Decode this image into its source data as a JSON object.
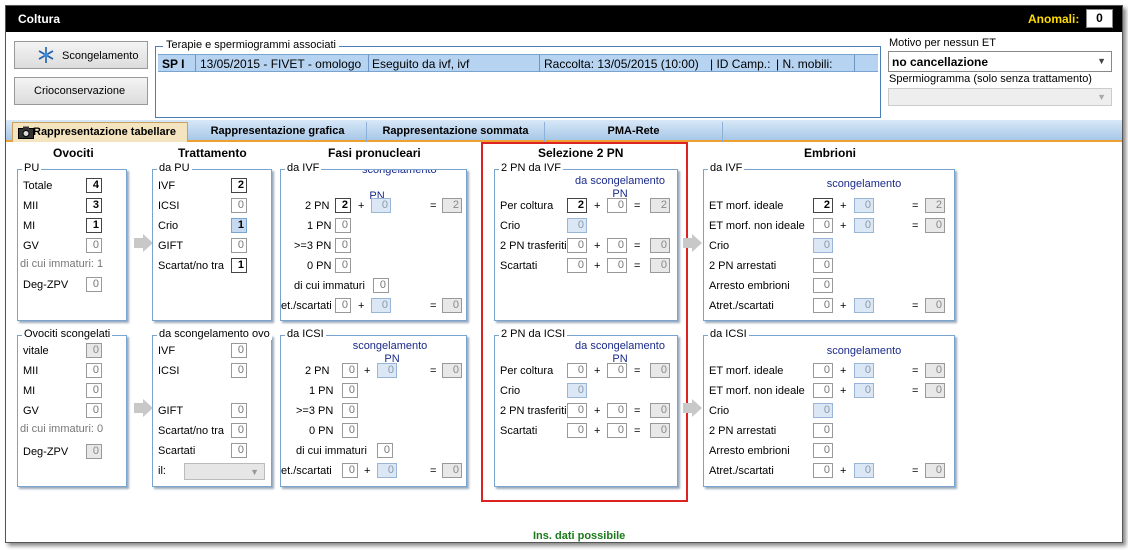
{
  "window": {
    "title": "Coltura",
    "anomali_label": "Anomali:",
    "anomali_value": "0"
  },
  "buttons": {
    "scongelamento": "Scongelamento",
    "crioconservazione": "Crioconservazione"
  },
  "associati": {
    "legend": "Terapie e spermiogrammi associati",
    "row": {
      "c1": "SP I",
      "c2": "13/05/2015 - FIVET - omologo",
      "c3": "Eseguito da ivf, ivf",
      "c4": "Raccolta: 13/05/2015 (10:00)",
      "c5": "| ID Camp.:",
      "c6": "| N. mobili:"
    }
  },
  "motivo": {
    "label": "Motivo per nessun ET",
    "value": "no cancellazione",
    "sperm_label": "Spermiogramma (solo senza trattamento)"
  },
  "tabs": [
    "Rappresentazione tabellare",
    "Rappresentazione grafica",
    "Rappresentazione sommata",
    "PMA-Rete"
  ],
  "headers": {
    "ovociti": "Ovociti",
    "trattamento": "Trattamento",
    "fasi": "Fasi pronucleari",
    "selezione": "Selezione 2 PN",
    "embrioni": "Embrioni"
  },
  "pu": {
    "legend": "PU",
    "rows": [
      {
        "label": "Totale",
        "value": "4"
      },
      {
        "label": "MII",
        "value": "3"
      },
      {
        "label": "MI",
        "value": "1"
      },
      {
        "label": "GV",
        "value": "0"
      }
    ],
    "immaturi": "di cui immaturi:  1",
    "deg_label": "Deg-ZPV",
    "deg_value": "0"
  },
  "scong": {
    "legend": "Ovociti scongelati",
    "rows": [
      {
        "label": "vitale",
        "value": "0"
      },
      {
        "label": "MII",
        "value": "0"
      },
      {
        "label": "MI",
        "value": "0"
      },
      {
        "label": "GV",
        "value": "0"
      }
    ],
    "immaturi": "di cui immaturi: 0",
    "deg_label": "Deg-ZPV",
    "deg_value": "0"
  },
  "tr_pu": {
    "legend": "da PU",
    "rows": [
      {
        "label": "IVF",
        "value": "2"
      },
      {
        "label": "ICSI",
        "value": "0"
      },
      {
        "label": "Crio",
        "value": "1"
      },
      {
        "label": "GIFT",
        "value": "0"
      },
      {
        "label": "Scartat/no tra",
        "value": "1"
      }
    ]
  },
  "tr_sc": {
    "legend": "da scongelamento ovo",
    "rows": [
      {
        "label": "IVF",
        "value": "0"
      },
      {
        "label": "ICSI",
        "value": "0"
      },
      {
        "label": "GIFT",
        "value": "0"
      },
      {
        "label": "Scartat/no tra",
        "value": "0"
      },
      {
        "label": "Scartati",
        "value": "0"
      }
    ],
    "il_label": "il:"
  },
  "fasi_ivf": {
    "legend": "da IVF",
    "sub": "scongelamento",
    "sub2": "PN",
    "rows": [
      {
        "label": "2 PN",
        "a": "2",
        "b": "0",
        "c": "2"
      },
      {
        "label": "1 PN",
        "a": "0"
      },
      {
        "label": ">=3 PN",
        "a": "0"
      },
      {
        "label": "0 PN",
        "a": "0"
      }
    ],
    "immaturi_label": "di cui immaturi",
    "immaturi": "0",
    "atret_label": "et./scartati",
    "atret_a": "0",
    "atret_b": "0",
    "atret_c": "0"
  },
  "fasi_icsi": {
    "legend": "da ICSI",
    "sub": "scongelamento",
    "sub2": "PN",
    "rows": [
      {
        "label": "2 PN",
        "a": "0",
        "b": "0",
        "c": "0"
      },
      {
        "label": "1 PN",
        "a": "0"
      },
      {
        "label": ">=3 PN",
        "a": "0"
      },
      {
        "label": "0 PN",
        "a": "0"
      }
    ],
    "immaturi_label": "di cui immaturi",
    "immaturi": "0",
    "atret_label": "et./scartati",
    "atret_a": "0",
    "atret_b": "0",
    "atret_c": "0"
  },
  "sel_ivf": {
    "legend": "2 PN da IVF",
    "sub": "da scongelamento",
    "sub2": "PN",
    "rows": [
      {
        "label": "Per coltura",
        "a": "2",
        "b": "0",
        "c": "2"
      },
      {
        "label": "Crio",
        "a": "0"
      },
      {
        "label": "2 PN trasferiti",
        "a": "0",
        "b": "0",
        "c": "0"
      },
      {
        "label": "Scartati",
        "a": "0",
        "b": "0",
        "c": "0"
      }
    ]
  },
  "sel_icsi": {
    "legend": "2 PN da ICSI",
    "sub": "da scongelamento",
    "sub2": "PN",
    "rows": [
      {
        "label": "Per coltura",
        "a": "0",
        "b": "0",
        "c": "0"
      },
      {
        "label": "Crio",
        "a": "0"
      },
      {
        "label": "2 PN trasferiti",
        "a": "0",
        "b": "0",
        "c": "0"
      },
      {
        "label": "Scartati",
        "a": "0",
        "b": "0",
        "c": "0"
      }
    ]
  },
  "emb_ivf": {
    "legend": "da IVF",
    "sub": "scongelamento",
    "rows": [
      {
        "label": "ET morf. ideale",
        "a": "2",
        "b": "0",
        "c": "2"
      },
      {
        "label": "ET morf. non ideale",
        "a": "0",
        "b": "0",
        "c": "0"
      },
      {
        "label": "Crio",
        "a": "0"
      },
      {
        "label": "2 PN arrestati",
        "a": "0"
      },
      {
        "label": "Arresto embrioni",
        "a": "0"
      },
      {
        "label": "Atret./scartati",
        "a": "0",
        "b": "0",
        "c": "0"
      }
    ]
  },
  "emb_icsi": {
    "legend": "da ICSI",
    "sub": "scongelamento",
    "rows": [
      {
        "label": "ET morf. ideale",
        "a": "0",
        "b": "0",
        "c": "0"
      },
      {
        "label": "ET morf. non ideale",
        "a": "0",
        "b": "0",
        "c": "0"
      },
      {
        "label": "Crio",
        "a": "0"
      },
      {
        "label": "2 PN arrestati",
        "a": "0"
      },
      {
        "label": "Arresto embrioni",
        "a": "0"
      },
      {
        "label": "Atret./scartati",
        "a": "0",
        "b": "0",
        "c": "0"
      }
    ]
  },
  "symbols": {
    "plus": "+",
    "equals": "="
  },
  "status": "Ins. dati possibile"
}
